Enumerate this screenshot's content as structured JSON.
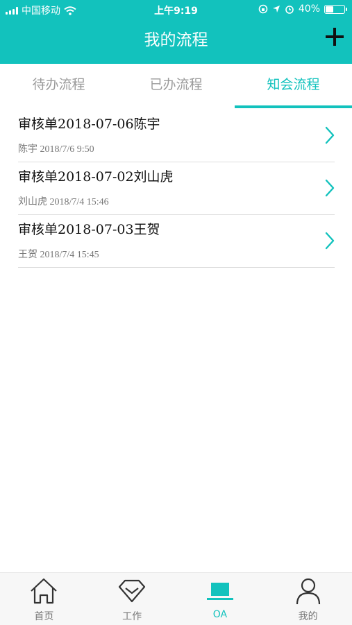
{
  "status_bar": {
    "carrier": "中国移动",
    "time": "上午9:19",
    "battery": "40%",
    "battery_level": 0.4
  },
  "header": {
    "title": "我的流程",
    "add_icon": "plus-icon"
  },
  "tabs": [
    {
      "label": "待办流程",
      "active": false
    },
    {
      "label": "已办流程",
      "active": false
    },
    {
      "label": "知会流程",
      "active": true
    }
  ],
  "items": [
    {
      "title": "审核单2018-07-06陈宇",
      "meta": "陈宇 2018/7/6 9:50"
    },
    {
      "title": "审核单2018-07-02刘山虎",
      "meta": "刘山虎 2018/7/4 15:46"
    },
    {
      "title": "审核单2018-07-03王贺",
      "meta": "王贺 2018/7/4 15:45"
    }
  ],
  "tabbar": [
    {
      "label": "首页",
      "icon": "home-icon",
      "active": false
    },
    {
      "label": "工作",
      "icon": "diamond-icon",
      "active": false
    },
    {
      "label": "OA",
      "icon": "laptop-icon",
      "active": true
    },
    {
      "label": "我的",
      "icon": "user-icon",
      "active": false
    }
  ],
  "colors": {
    "accent": "#12c2bd",
    "inactive": "#9a9a9a"
  }
}
